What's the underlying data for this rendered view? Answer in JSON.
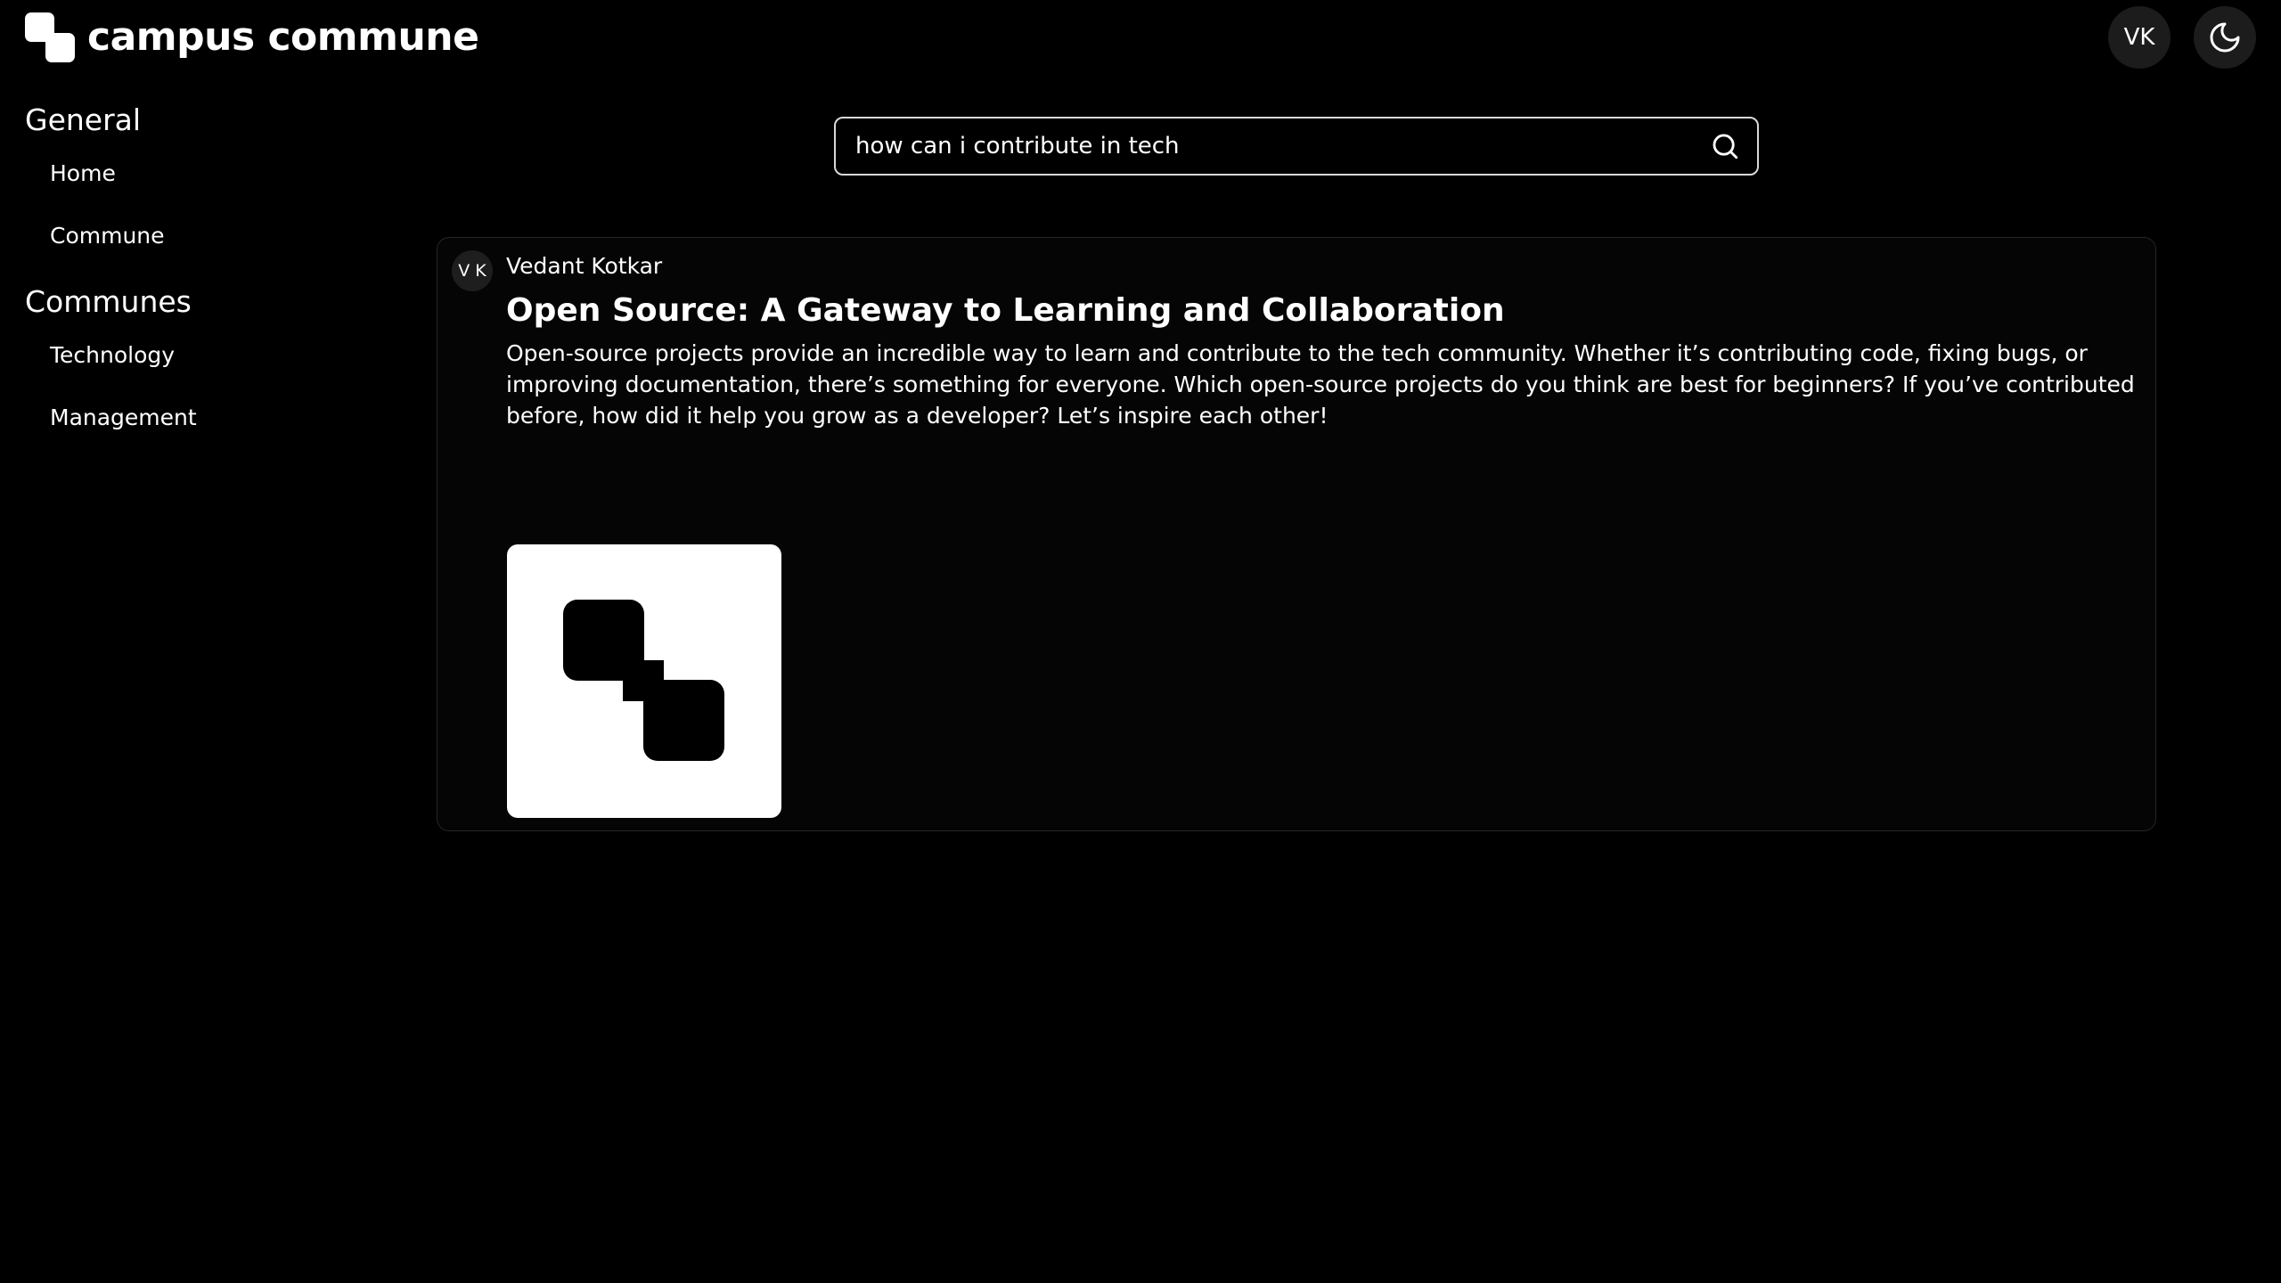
{
  "app": {
    "name": "campus commune"
  },
  "header": {
    "user_initials": "VK",
    "theme_icon": "moon-icon"
  },
  "sidebar": {
    "sections": [
      {
        "title": "General",
        "items": [
          {
            "label": "Home"
          },
          {
            "label": "Commune"
          }
        ]
      },
      {
        "title": "Communes",
        "items": [
          {
            "label": "Technology"
          },
          {
            "label": "Management"
          }
        ]
      }
    ]
  },
  "search": {
    "value": "how can i contribute in tech",
    "icon": "search-icon"
  },
  "post": {
    "author_initials": "V K",
    "author_name": "Vedant Kotkar",
    "title": "Open Source: A Gateway to Learning and Collaboration",
    "body": "Open-source projects provide an incredible way to learn and contribute to the tech community. Whether it’s contributing code, fixing bugs, or improving documentation, there’s something for everyone. Which open-source projects do you think are best for beginners? If you’ve contributed before, how did it help you grow as a developer? Let’s inspire each other!"
  }
}
